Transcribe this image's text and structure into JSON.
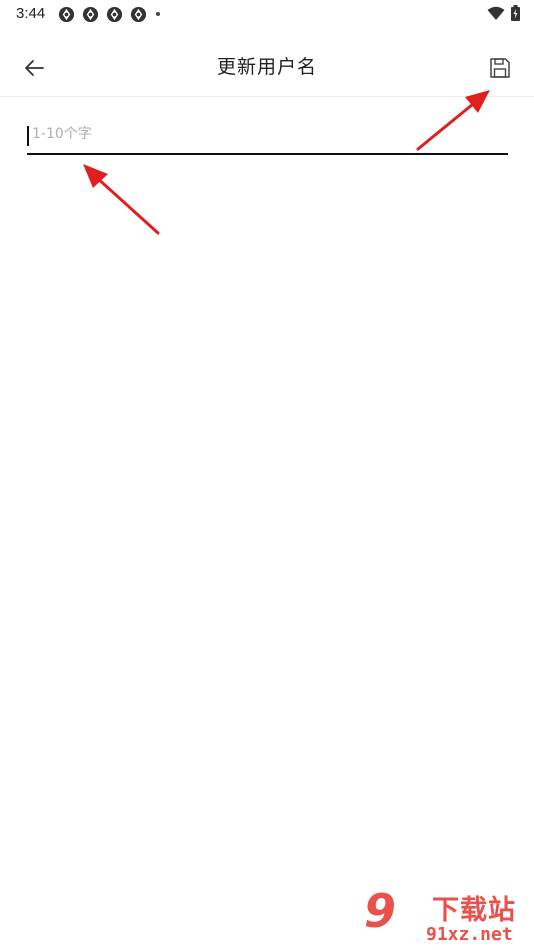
{
  "status_bar": {
    "time": "3:44",
    "notification_icons": [
      "app-notification-icon",
      "app-notification-icon",
      "app-notification-icon",
      "app-notification-icon"
    ],
    "system_icons": [
      "wifi-icon",
      "battery-charging-icon"
    ]
  },
  "toolbar": {
    "back_icon": "arrow-left-icon",
    "title": "更新用户名",
    "save_icon": "floppy-disk-icon"
  },
  "username_field": {
    "value": "",
    "placeholder": "1-10个字"
  },
  "colors": {
    "annotation_arrow": "#e02020",
    "underline": "#111111",
    "placeholder": "#b0b0b0",
    "watermark": "#e9514a"
  },
  "watermark": {
    "mark": "9",
    "title": "下载站",
    "domain": "91xz.net"
  }
}
